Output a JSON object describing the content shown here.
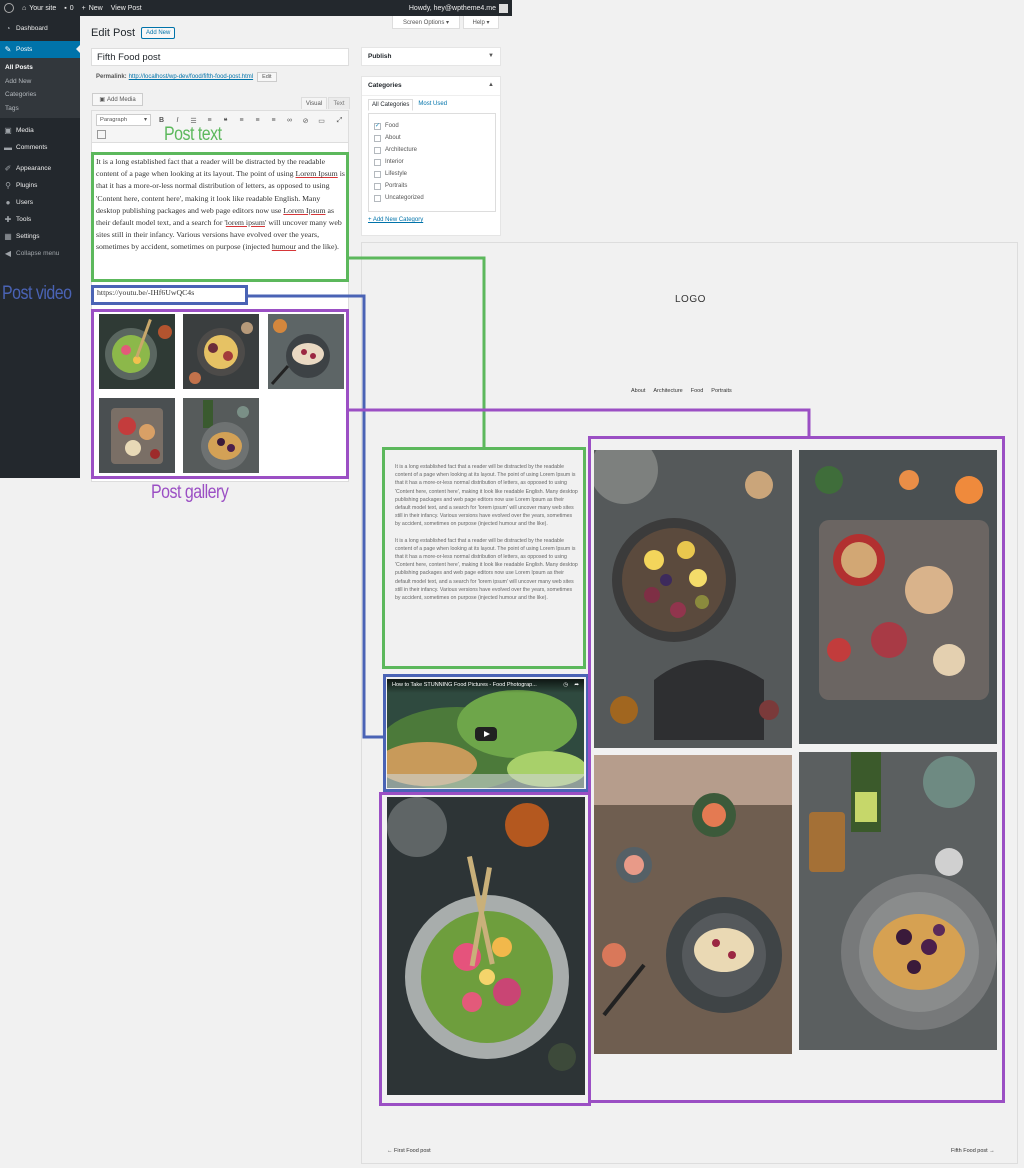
{
  "adminbar": {
    "site": "Your site",
    "comments_count": "0",
    "new_label": "New",
    "view_post": "View Post",
    "howdy": "Howdy, hey@wptheme4.me"
  },
  "sidebar": {
    "items": [
      {
        "label": "Dashboard",
        "icon": "dashboard-icon"
      },
      {
        "label": "Posts",
        "icon": "pin-icon"
      },
      {
        "label": "Media",
        "icon": "media-icon"
      },
      {
        "label": "Comments",
        "icon": "comment-icon"
      },
      {
        "label": "Appearance",
        "icon": "brush-icon"
      },
      {
        "label": "Plugins",
        "icon": "plug-icon"
      },
      {
        "label": "Users",
        "icon": "user-icon"
      },
      {
        "label": "Tools",
        "icon": "wrench-icon"
      },
      {
        "label": "Settings",
        "icon": "settings-icon"
      },
      {
        "label": "Collapse menu",
        "icon": "collapse-icon"
      }
    ],
    "posts_submenu": [
      "All Posts",
      "Add New",
      "Categories",
      "Tags"
    ]
  },
  "editor": {
    "page_title": "Edit Post",
    "add_new": "Add New",
    "screen_options": "Screen Options ▾",
    "help": "Help ▾",
    "post_title": "Fifth Food post",
    "permalink_label": "Permalink:",
    "permalink_url": "http://localhost/wp-dev/food/fifth-food-post.html",
    "permalink_edit": "Edit",
    "add_media": "Add Media",
    "tab_visual": "Visual",
    "tab_text": "Text",
    "format_select": "Paragraph",
    "video_url": "https://youtu.be/-IHf6UwQC4s"
  },
  "post_text": {
    "p1": "It is a long established fact that a reader will be distracted by the readable content of a page when looking at its layout. The point of using ",
    "s1": "Lorem Ipsum",
    "p2": " is that it has a more-or-less normal distribution of letters, as opposed to using 'Content here, content here', making it look like readable English. Many desktop publishing packages and web page editors now use ",
    "s2": "Lorem Ipsum",
    "p3": " as their default model text, and a search for '",
    "s3": "lorem ipsum",
    "p4": "' will uncover many web sites still in their infancy. Various versions have evolved over the years, sometimes by accident, sometimes on purpose (injected ",
    "s4": "humour",
    "p5": " and the like)."
  },
  "publish_box": {
    "title": "Publish"
  },
  "categories": {
    "title": "Categories",
    "tab_all": "All Categories",
    "tab_most": "Most Used",
    "items": [
      {
        "label": "Food",
        "checked": true
      },
      {
        "label": "About",
        "checked": false
      },
      {
        "label": "Architecture",
        "checked": false
      },
      {
        "label": "Interior",
        "checked": false
      },
      {
        "label": "Lifestyle",
        "checked": false
      },
      {
        "label": "Portraits",
        "checked": false
      },
      {
        "label": "Uncategorized",
        "checked": false
      }
    ],
    "add_new": "+ Add New Category"
  },
  "frontend": {
    "logo": "LOGO",
    "nav": [
      "About",
      "Architecture",
      "Food",
      "Portraits"
    ],
    "para1": "It is a long established fact that a reader will be distracted by the readable content of a page when looking at its layout. The point of using Lorem Ipsum is that it has a more-or-less normal distribution of letters, as opposed to using 'Content here, content here', making it look like readable English. Many desktop publishing packages and web page editors now use Lorem Ipsum as their default model text, and a search for 'lorem ipsum' will uncover many web sites still in their infancy. Various versions have evolved over the years, sometimes by accident, sometimes on purpose (injected humour and the like).",
    "para2": "It is a long established fact that a reader will be distracted by the readable content of a page when looking at its layout. The point of using Lorem Ipsum is that it has a more-or-less normal distribution of letters, as opposed to using 'Content here, content here', making it look like readable English. Many desktop publishing packages and web page editors now use Lorem Ipsum as their default model text, and a search for 'lorem ipsum' will uncover many web sites still in their infancy. Various versions have evolved over the years, sometimes by accident, sometimes on purpose (injected humour and the like).",
    "video_title": "How to Take STUNNING Food Pictures - Food Photograp...",
    "prev_post": "← First Food post",
    "next_post": "Fifth Food post →"
  },
  "annotations": {
    "post_text": "Post text",
    "post_video": "Post video",
    "post_gallery": "Post gallery"
  },
  "colors": {
    "green": "#5cb85c",
    "blue": "#4a63b5",
    "purple": "#9b4fc4",
    "wp_blue": "#0073aa",
    "admin_dark": "#23282d"
  }
}
